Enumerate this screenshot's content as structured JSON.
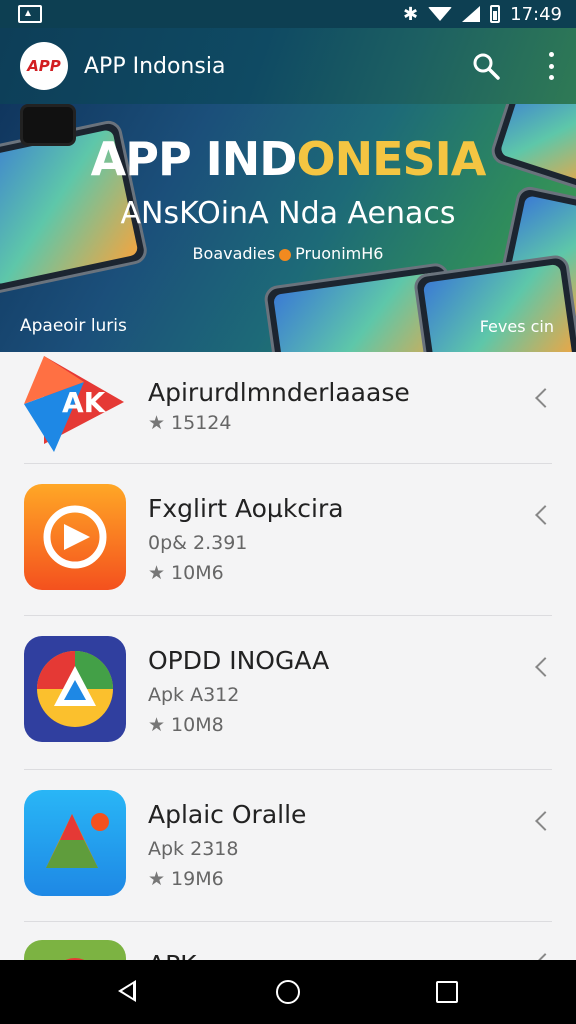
{
  "status_bar": {
    "time": "17:49"
  },
  "app_bar": {
    "logo_text": "APP",
    "title": "APP Indonsia"
  },
  "banner": {
    "title_part1": "APP IND",
    "title_part2": "ONESIA",
    "subtitle": "ANsKOinA Nda Aenacs",
    "tag_left": "Boavadies",
    "tag_right": "PruonimH6",
    "caption_left": "Apaeoir luris",
    "caption_right": "Feves cin"
  },
  "apps": [
    {
      "name": "Apirurdlmnderlaaase",
      "lines": [
        {
          "star": false,
          "text": ""
        },
        {
          "star": true,
          "text": "15124"
        }
      ]
    },
    {
      "name": "Fxglirt Aoµkcira",
      "lines": [
        {
          "star": false,
          "text": "0p& 2.391"
        },
        {
          "star": true,
          "text": "10M6"
        }
      ]
    },
    {
      "name": "OPDD INOGAA",
      "lines": [
        {
          "star": false,
          "text": "Apk A312"
        },
        {
          "star": true,
          "text": "10M8"
        }
      ]
    },
    {
      "name": "Aplaic Oralle",
      "lines": [
        {
          "star": false,
          "text": "Apk 2318"
        },
        {
          "star": true,
          "text": "19M6"
        }
      ]
    },
    {
      "name": "APK",
      "lines": []
    }
  ],
  "colors": {
    "appbar": "#0f4a63",
    "accent": "#f4c542",
    "background": "#f4f4f5"
  }
}
